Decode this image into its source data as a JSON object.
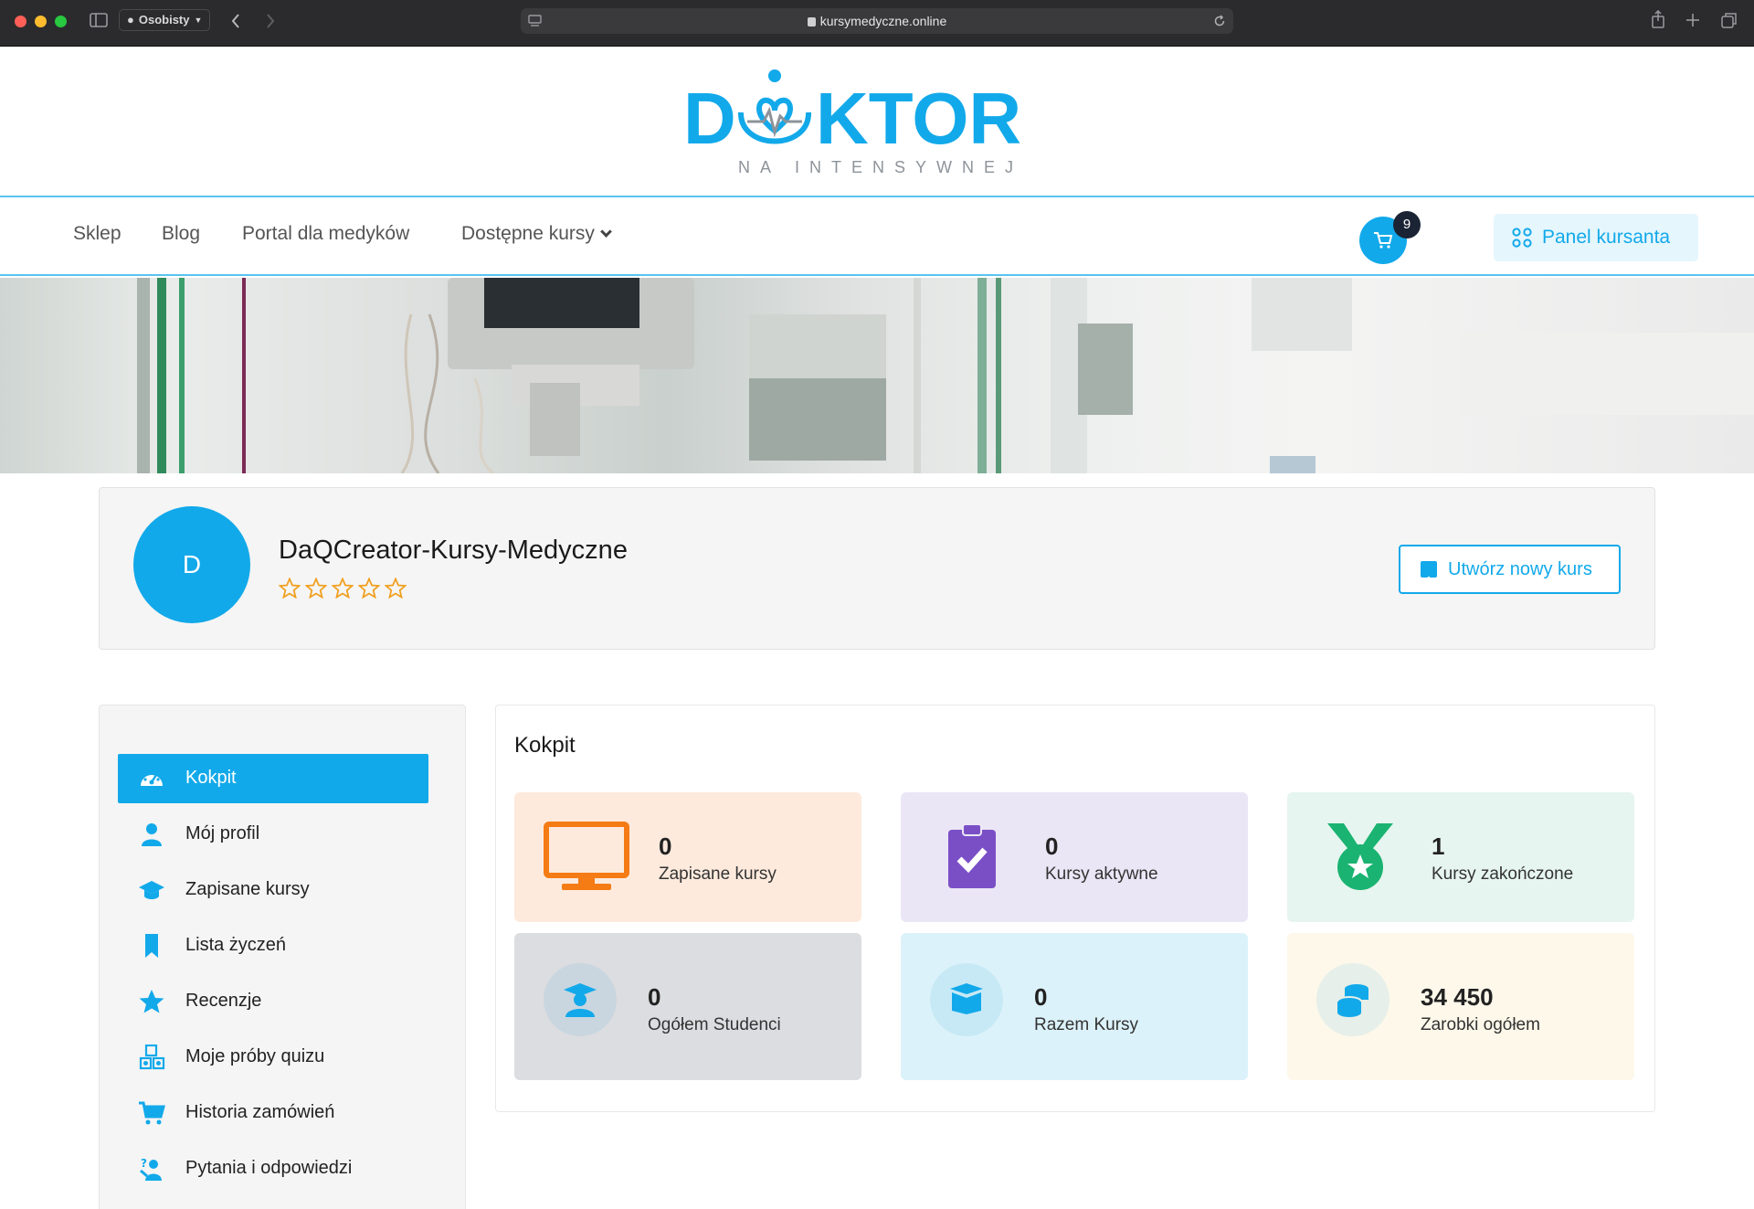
{
  "browser": {
    "profile": "Osobisty",
    "url": "kursymedyczne.online"
  },
  "logo": {
    "main": "DOKTOR",
    "sub": "NA INTENSYWNEJ"
  },
  "nav": {
    "items": [
      "Sklep",
      "Blog",
      "Portal dla medyków",
      "Dostępne kursy"
    ],
    "cart_count": "9",
    "panel_label": "Panel kursanta"
  },
  "profile": {
    "avatar_letter": "D",
    "name": "DaQCreator-Kursy-Medyczne",
    "rating": 0,
    "create_button": "Utwórz nowy kurs"
  },
  "sidebar": {
    "items": [
      {
        "label": "Kokpit",
        "icon": "dashboard-icon",
        "active": true
      },
      {
        "label": "Mój profil",
        "icon": "user-icon",
        "active": false
      },
      {
        "label": "Zapisane kursy",
        "icon": "graduation-cap-icon",
        "active": false
      },
      {
        "label": "Lista życzeń",
        "icon": "bookmark-icon",
        "active": false
      },
      {
        "label": "Recenzje",
        "icon": "star-icon",
        "active": false
      },
      {
        "label": "Moje próby quizu",
        "icon": "quiz-shapes-icon",
        "active": false
      },
      {
        "label": "Historia zamówień",
        "icon": "cart-icon",
        "active": false
      },
      {
        "label": "Pytania i odpowiedzi",
        "icon": "question-answer-icon",
        "active": false
      }
    ]
  },
  "dashboard": {
    "title": "Kokpit",
    "stats": [
      {
        "value": "0",
        "label": "Zapisane kursy",
        "icon": "monitor-icon",
        "bg": "#fdeadd"
      },
      {
        "value": "0",
        "label": "Kursy aktywne",
        "icon": "clipboard-check-icon",
        "bg": "#ebe6f6"
      },
      {
        "value": "1",
        "label": "Kursy zakończone",
        "icon": "medal-icon",
        "bg": "#e6f5ef"
      },
      {
        "value": "0",
        "label": "Ogółem Studenci",
        "icon": "student-icon",
        "bg": "#dcdde0"
      },
      {
        "value": "0",
        "label": "Razem Kursy",
        "icon": "box-icon",
        "bg": "#dcf2fa"
      },
      {
        "value": "34 450",
        "label": "Zarobki ogółem",
        "icon": "coins-icon",
        "bg": "#fdf8ea"
      }
    ]
  },
  "colors": {
    "accent": "#12a9ea",
    "nav_border": "#59c4ef"
  }
}
